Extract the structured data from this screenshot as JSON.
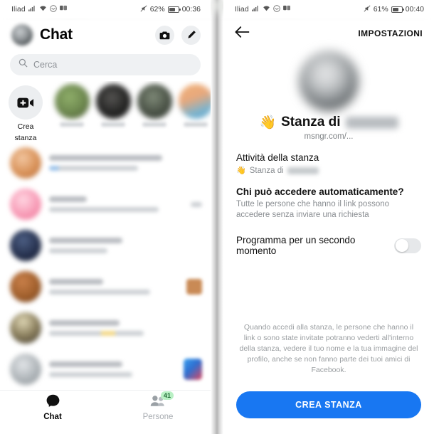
{
  "left": {
    "statusbar": {
      "carrier": "Iliad",
      "icons": [
        "signal-icon",
        "wifi-icon",
        "message-icon",
        "dual-sim-icon",
        "mute-icon"
      ],
      "battery": "62%",
      "clock": "00:36"
    },
    "header": {
      "title": "Chat",
      "avatar": "user-avatar",
      "camera_icon": "camera-icon",
      "edit_icon": "edit-pencil-icon"
    },
    "search": {
      "placeholder": "Cerca",
      "icon": "search-icon"
    },
    "rooms": {
      "create_label_line1": "Crea",
      "create_label_line2": "stanza",
      "create_icon": "video-plus-icon",
      "stories": [
        {
          "name": "story-avatar-1",
          "color1": "#8fae6a",
          "color2": "#5b7040"
        },
        {
          "name": "story-avatar-2",
          "color1": "#4a4a48",
          "color2": "#141414"
        },
        {
          "name": "story-avatar-3",
          "color1": "#6f7a6a",
          "color2": "#2d332c"
        },
        {
          "name": "story-avatar-4",
          "color1": "#e8a87c",
          "color2": "#6fa8c8"
        }
      ]
    },
    "chat_rows": [
      {
        "avatar_color1": "#e8b189",
        "avatar_color2": "#c2784a",
        "title_w": "62%",
        "sub_w": "80%",
        "thumb": "",
        "has_blue": true
      },
      {
        "avatar_color1": "#f8a9c0",
        "avatar_color2": "#e8597f",
        "title_w": "26%",
        "sub_w": "74%",
        "thumb": "",
        "has_blue": false
      },
      {
        "avatar_color1": "#3a4a6b",
        "avatar_color2": "#0f1730",
        "title_w": "42%",
        "sub_w": "36%",
        "thumb": "",
        "has_blue": false
      },
      {
        "avatar_color1": "#b3703c",
        "avatar_color2": "#6b3d1c",
        "title_w": "38%",
        "sub_w": "68%",
        "thumb": "#c98a55",
        "has_blue": false
      },
      {
        "avatar_color1": "#cfc6a6",
        "avatar_color2": "#4a4236",
        "title_w": "40%",
        "sub_w": "54%",
        "thumb": "",
        "has_blue": false
      },
      {
        "avatar_color1": "#cfd3d6",
        "avatar_color2": "#8d9397",
        "title_w": "54%",
        "sub_w": "62%",
        "thumb": "#3b7fe0",
        "has_blue": false
      }
    ],
    "tabbar": {
      "chat_label": "Chat",
      "chat_icon": "chat-bubble-icon",
      "people_label": "Persone",
      "people_icon": "people-icon",
      "people_badge": "41"
    }
  },
  "right": {
    "statusbar": {
      "carrier": "Iliad",
      "battery": "61%",
      "clock": "00:40"
    },
    "header": {
      "back_icon": "back-arrow-icon",
      "title": "IMPOSTAZIONI"
    },
    "hero": {
      "avatar": "room-host-avatar",
      "emoji": "👋",
      "name": "Stanza di",
      "url": "msngr.com/..."
    },
    "sections": {
      "activity_title": "Attività della stanza",
      "activity_emoji": "👋",
      "activity_value": "Stanza di",
      "access_title": "Chi può accedere automaticamente?",
      "access_sub": "Tutte le persone che hanno il link possono accedere senza inviare una richiesta"
    },
    "toggle": {
      "label": "Programma per un secondo momento",
      "state": "off"
    },
    "disclaimer": "Quando accedi alla stanza, le persone che hanno il link o sono state invitate potranno vederti all'interno della stanza, vedere il tuo nome e la tua immagine del profilo, anche se non fanno parte dei tuoi amici di Facebook.",
    "cta": {
      "label": "CREA STANZA",
      "color": "#1877f2"
    }
  }
}
